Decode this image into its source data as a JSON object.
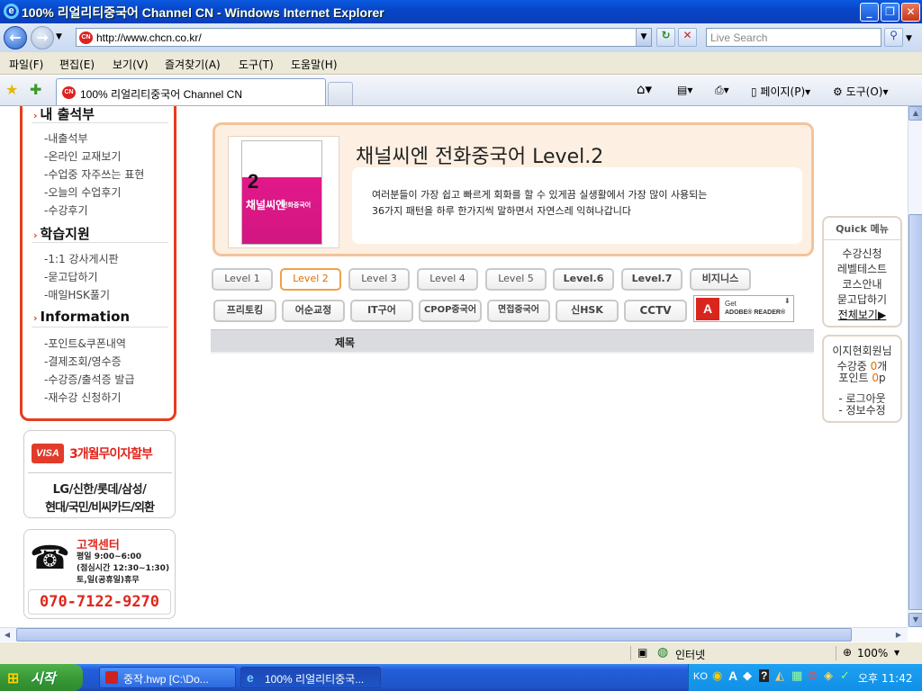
{
  "window": {
    "title": "100% 리얼리티중국어 Channel CN - Windows Internet Explorer",
    "url": "http://www.chcn.co.kr/",
    "search_placeholder": "Live Search",
    "menu": [
      "파일(F)",
      "편집(E)",
      "보기(V)",
      "즐겨찾기(A)",
      "도구(T)",
      "도움말(H)"
    ],
    "tab_title": "100% 리얼리티중국어 Channel CN",
    "toolbar": {
      "page": "페이지(P)",
      "tools": "도구(O)"
    }
  },
  "sidebar": {
    "sections": [
      {
        "title": "내 출석부",
        "items": [
          "-내출석부",
          "-온라인 교재보기",
          "-수업중 자주쓰는 표현",
          "-오늘의 수업후기",
          "-수강후기"
        ]
      },
      {
        "title": "학습지원",
        "items": [
          "-1:1 강사게시판",
          "-묻고답하기",
          "-매일HSK풀기"
        ]
      },
      {
        "title": "Information",
        "items": [
          "-포인트&쿠폰내역",
          "-결제조회/영수증",
          "-수강증/출석증 발급",
          "-재수강 신청하기"
        ]
      }
    ],
    "card_promo": {
      "visa": "VISA",
      "headline": "3개월무이자할부",
      "cards_line1": "LG/신한/롯데/삼성/",
      "cards_line2": "현대/국민/비씨카드/외환"
    },
    "support": {
      "title": "고객센터",
      "line1": "평일 9:00~6:00",
      "line2": "(점심시간 12:30~1:30)",
      "line3": "토,일(공휴일)휴무",
      "phone": "070-7122-9270"
    }
  },
  "banner": {
    "title": "채널씨엔 전화중국어 Level.2",
    "desc1": "여러분들이 가장 쉽고 빠르게 회화를 할 수 있게끔 실생활에서 가장 많이 사용되는",
    "desc2": "36가지 패턴을 하루 한가지씩 말하면서 자연스레 익혀나갑니다",
    "book_number": "2",
    "book_title": "채널씨엔",
    "book_sub": "전화중국어"
  },
  "levels_row1": [
    "Level 1",
    "Level 2",
    "Level 3",
    "Level 4",
    "Level 5",
    "Level.6",
    "Level.7",
    "비지니스"
  ],
  "levels_row2": [
    "프리토킹",
    "어순교정",
    "IT구어",
    "CPOP중국어",
    "면접중국어",
    "신HSK",
    "CCTV"
  ],
  "adobe": {
    "get": "Get",
    "reader": "ADOBE® READER®"
  },
  "table_header": "제목",
  "quick_menu": {
    "title": "Quick 메뉴",
    "items": [
      "수강신청",
      "레벨테스트",
      "코스안내",
      "묻고답하기"
    ],
    "view_all": "전체보기▶"
  },
  "user_box": {
    "name": "이지현회원님",
    "enrolled_label": "수강중 ",
    "enrolled_count": "0",
    "enrolled_unit": "개",
    "points_label": "포인트 ",
    "points": "0",
    "points_unit": "p",
    "logout": "- 로그아웃",
    "edit": "- 정보수정"
  },
  "statusbar": {
    "zone": "인터넷",
    "zoom": "100%"
  },
  "taskbar": {
    "start": "시작",
    "tasks": [
      "중작.hwp [C:\\Do...",
      "100% 리얼리티중국..."
    ],
    "lang": "KO",
    "time": "오후 11:42"
  },
  "colors": {
    "accent": "#e63b1e",
    "banner_border": "#f3c39c",
    "selected_level": "#f0a14d",
    "book_pink": "#e2188b"
  }
}
